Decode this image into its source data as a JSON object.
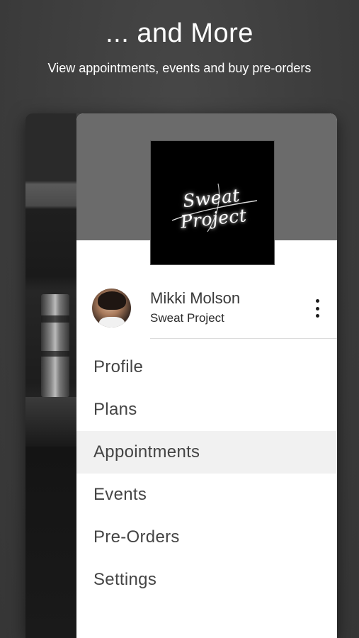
{
  "promo": {
    "title": "... and More",
    "subtitle": "View appointments, events and buy pre-orders"
  },
  "drawer": {
    "logo_text": "Sweat Project",
    "user": {
      "name": "Mikki Molson",
      "org": "Sweat Project"
    },
    "menu": [
      {
        "label": "Profile"
      },
      {
        "label": "Plans"
      },
      {
        "label": "Appointments",
        "active": true
      },
      {
        "label": "Events"
      },
      {
        "label": "Pre-Orders"
      },
      {
        "label": "Settings"
      }
    ]
  },
  "colors": {
    "page_bg": "#3e3e3e",
    "header_bg": "#6b6b6b",
    "active_item_bg": "#f1f1f1",
    "text_dark": "#444444"
  },
  "icons": {
    "more": "more-vertical-icon"
  }
}
